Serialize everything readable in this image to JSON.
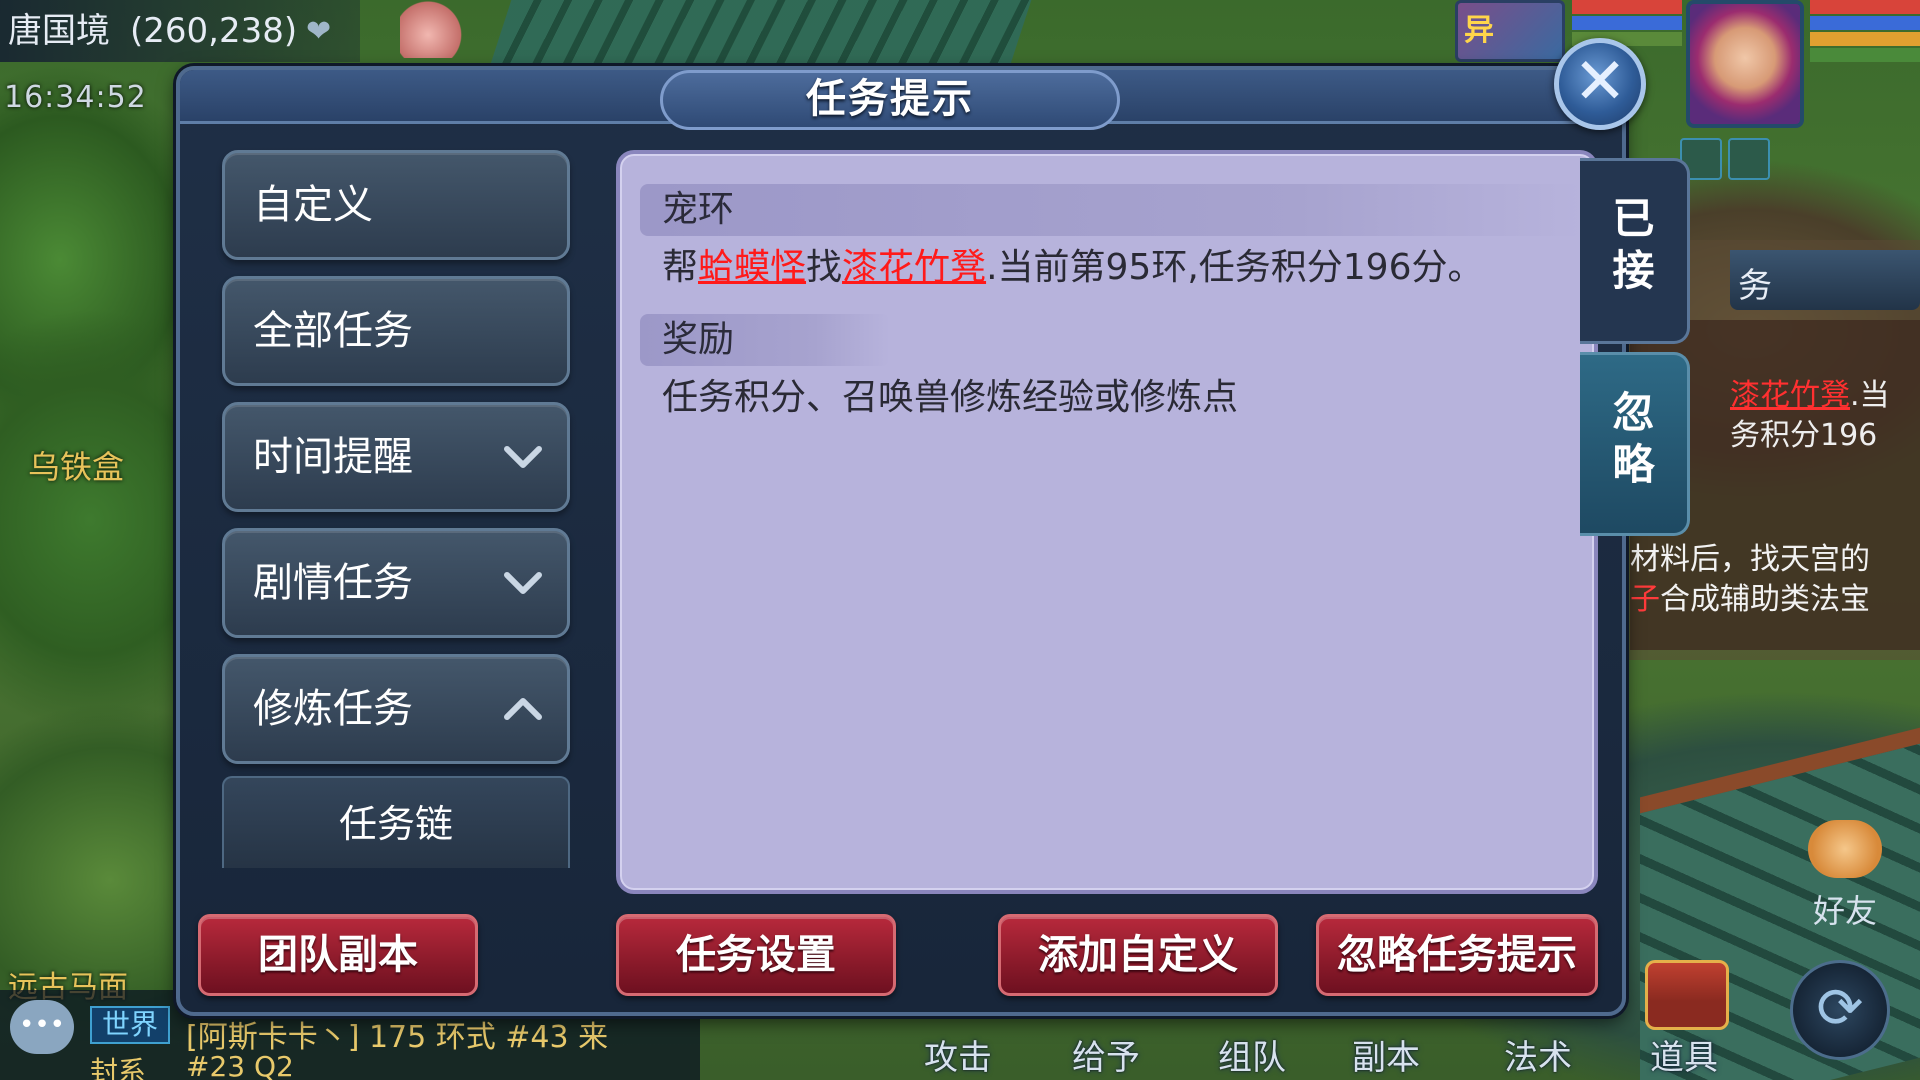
{
  "hud": {
    "location": "唐国境",
    "coords": "(260,238)",
    "time": "16:34:52",
    "pet_tag": "异"
  },
  "dialog": {
    "title": "任务提示",
    "categories": [
      {
        "label": "自定义",
        "chevron": "none"
      },
      {
        "label": "全部任务",
        "chevron": "none"
      },
      {
        "label": "时间提醒",
        "chevron": "down"
      },
      {
        "label": "剧情任务",
        "chevron": "down"
      },
      {
        "label": "修炼任务",
        "chevron": "up"
      }
    ],
    "sub_item": "任务链",
    "content": {
      "task_title": "宠环",
      "task_desc_parts": [
        "帮",
        "蛤蟆怪",
        "找",
        "漆花竹凳",
        ".当前第95环,任务积分196分。"
      ],
      "reward_title": "奖励",
      "reward_text": "任务积分、召唤兽修炼经验或修炼点"
    },
    "side_tabs": {
      "accepted": [
        "已",
        "接"
      ],
      "ignored": [
        "忽",
        "略"
      ]
    },
    "actions": {
      "team_dungeon": "团队副本",
      "task_settings": "任务设置",
      "add_custom": "添加自定义",
      "ignore_hint": "忽略任务提示"
    }
  },
  "background_ui": {
    "side_task_line1_red": "漆花竹凳",
    "side_task_line1_rest": ".当",
    "side_task_line2": "务积分196",
    "side_task_line3": "材料后，找天宫的",
    "side_task_line4_red": "子",
    "side_task_line4_rest": "合成辅助类法宝",
    "side_tab_fragment": "务",
    "npc_label_1": "乌铁盒",
    "npc_label_2": "远古马面",
    "chat_channel": "世界",
    "chat_message": "[阿斯卡卡丶] 175 环式  #43  来",
    "chat_message2_left": "封系",
    "chat_message2_right": "#23 Q2",
    "bottom_actions": [
      "攻击",
      "给予",
      "组队",
      "副本",
      "法术",
      "道具"
    ],
    "friend_label": "好友"
  },
  "colors": {
    "accent_red_button": "#8a1a2a",
    "link_red": "#ff1a1a",
    "content_lavender": "#b7b3dc",
    "dialog_navy": "#1f2f46"
  }
}
